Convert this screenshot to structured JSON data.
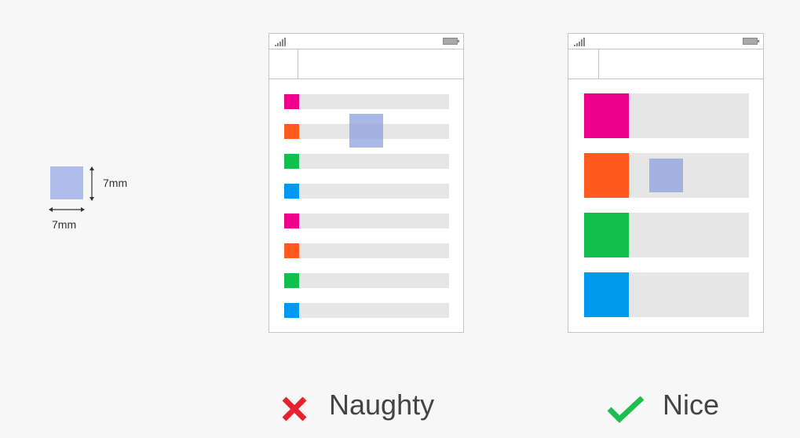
{
  "size_legend": {
    "vertical_label": "7mm",
    "horizontal_label": "7mm",
    "target_color": "#b0bdec"
  },
  "colors": {
    "magenta": "#ec008c",
    "orange": "#ff5a1f",
    "green": "#13c04e",
    "blue": "#0099f0",
    "row_bar": "#e6e6e6",
    "touch_target": "#8ea0e0"
  },
  "naughty": {
    "label": "Naughty",
    "icon": "cross-icon",
    "icon_color": "#e8212e",
    "rows": [
      "magenta",
      "orange",
      "green",
      "blue",
      "magenta",
      "orange",
      "green",
      "blue"
    ]
  },
  "nice": {
    "label": "Nice",
    "icon": "checkmark-icon",
    "icon_color": "#1fbf4f",
    "rows": [
      "magenta",
      "orange",
      "green",
      "blue"
    ]
  }
}
